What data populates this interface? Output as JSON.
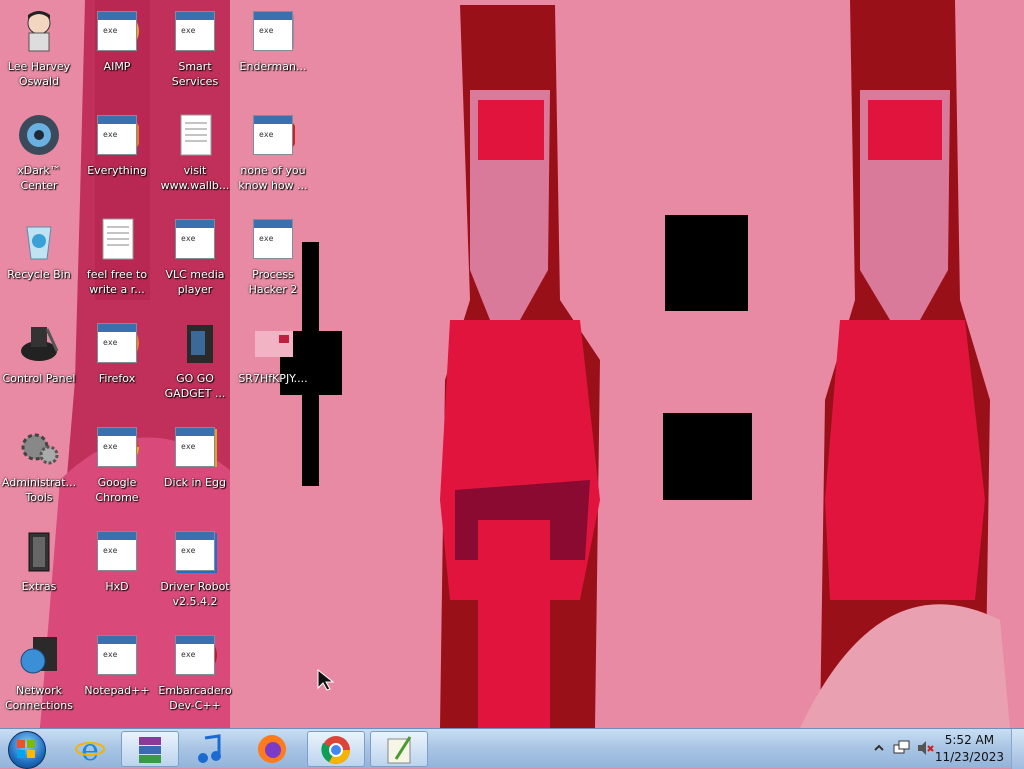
{
  "desktop": {
    "icons": [
      {
        "label": "Lee Harvey\nOswald",
        "icon": "person-icon"
      },
      {
        "label": "AIMP",
        "icon": "aimp-icon"
      },
      {
        "label": "Smart\nServices",
        "icon": "smart-services-icon"
      },
      {
        "label": "Enderman...",
        "icon": "window-icon"
      },
      {
        "label": "xDark™\nCenter",
        "icon": "xdark-icon"
      },
      {
        "label": "Everything",
        "icon": "everything-icon"
      },
      {
        "label": "visit\nwww.wallb...",
        "icon": "text-file-icon"
      },
      {
        "label": "none of you\nknow how ...",
        "icon": "app-icon"
      },
      {
        "label": "Recycle Bin",
        "icon": "recycle-bin-icon"
      },
      {
        "label": "feel free to\nwrite a r...",
        "icon": "text-file-icon"
      },
      {
        "label": "VLC media\nplayer",
        "icon": "vlc-icon"
      },
      {
        "label": "Process\nHacker 2",
        "icon": "process-hacker-icon"
      },
      {
        "label": "Control Panel",
        "icon": "control-panel-icon"
      },
      {
        "label": "Firefox",
        "icon": "firefox-icon"
      },
      {
        "label": "GO GO\nGADGET ...",
        "icon": "gadget-icon"
      },
      {
        "label": "SR7HfKPJY....",
        "icon": "image-file-icon"
      },
      {
        "label": "Administrat...\nTools",
        "icon": "admin-tools-icon"
      },
      {
        "label": "Google\nChrome",
        "icon": "chrome-icon"
      },
      {
        "label": "Dick in Egg",
        "icon": "egg-icon"
      },
      {
        "label": "Extras",
        "icon": "folder-icon"
      },
      {
        "label": "HxD",
        "icon": "hxd-icon"
      },
      {
        "label": "Driver Robot\nv2.5.4.2",
        "icon": "driver-robot-icon"
      },
      {
        "label": "Network\nConnections",
        "icon": "network-icon"
      },
      {
        "label": "Notepad++",
        "icon": "notepad-plus-icon"
      },
      {
        "label": "Embarcadero\nDev-C++",
        "icon": "devcpp-icon"
      }
    ]
  },
  "taskbar": {
    "start": "start-orb-icon",
    "pinned": [
      {
        "name": "internet-explorer-icon"
      },
      {
        "name": "winrar-icon"
      },
      {
        "name": "music-player-icon"
      },
      {
        "name": "firefox-icon"
      },
      {
        "name": "chrome-icon"
      },
      {
        "name": "notepad-edit-icon"
      }
    ],
    "clock": {
      "time": "5:52 AM",
      "date": "11/23/2023"
    }
  },
  "colors": {
    "wallpaper": "#e98aa4",
    "dress": "#e0143c",
    "hair": "#8a0a12"
  }
}
